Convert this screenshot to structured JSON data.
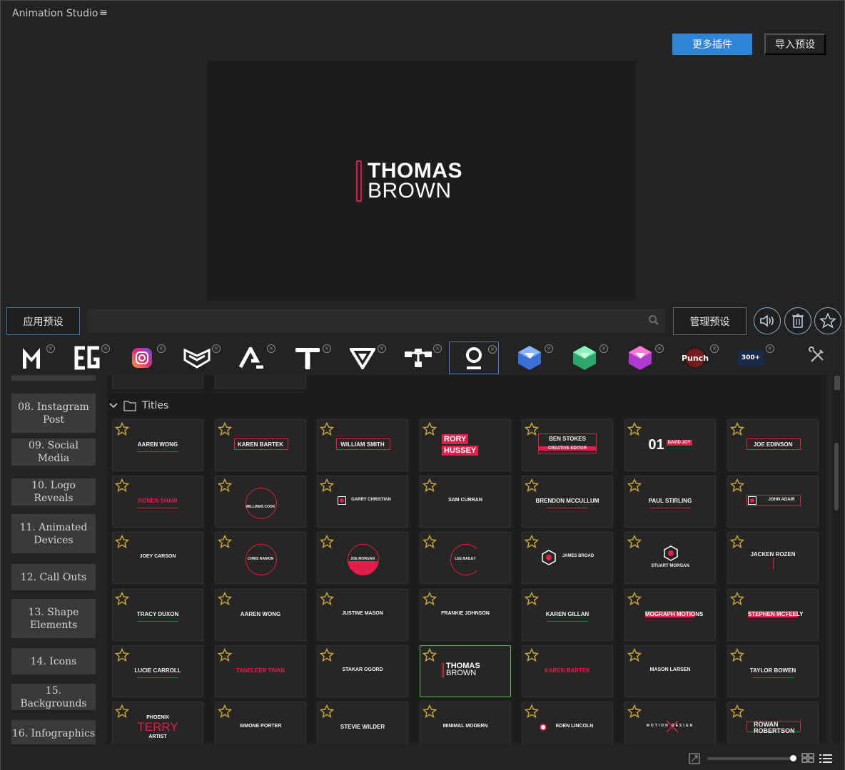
{
  "app": {
    "title": "Animation Studio"
  },
  "header": {
    "more_plugins": "更多插件",
    "import_preset": "导入预设"
  },
  "preview": {
    "line1": "THOMAS",
    "line2": "BROWN",
    "accent": "#e0204a"
  },
  "toolbar": {
    "apply": "应用预设",
    "manage": "管理预设",
    "search_placeholder": ""
  },
  "plugins": [
    {
      "name": "m-logo"
    },
    {
      "name": "eg-logo"
    },
    {
      "name": "instagram-logo"
    },
    {
      "name": "shield-logo"
    },
    {
      "name": "a-logo"
    },
    {
      "name": "t-logo"
    },
    {
      "name": "v-logo"
    },
    {
      "name": "nodes-logo"
    },
    {
      "name": "q-logo"
    },
    {
      "name": "cube-blue"
    },
    {
      "name": "cube-green"
    },
    {
      "name": "cube-pink"
    },
    {
      "name": "punch-logo",
      "label": "Punch"
    },
    {
      "name": "3000-logo",
      "label": "300+"
    }
  ],
  "sidebar": {
    "items": [
      {
        "label": "08. Instagram Post"
      },
      {
        "label": "09. Social Media"
      },
      {
        "label": "10. Logo Reveals"
      },
      {
        "label": "11. Animated Devices"
      },
      {
        "label": "12. Call Outs"
      },
      {
        "label": "13. Shape Elements"
      },
      {
        "label": "14. Icons"
      },
      {
        "label": "15. Backgrounds"
      },
      {
        "label": "16. Infographics"
      }
    ]
  },
  "folder": {
    "label": "Titles"
  },
  "tiles": [
    [
      "AAREN WONG",
      "KAREN BARTEK",
      "WILLIAM SMITH",
      "RORY HUSSEY",
      "BEN STOKES",
      "DAVID JOY",
      "JOE EDINSON"
    ],
    [
      "RONEN SHAW",
      "WILLIAMS COOK",
      "GARRY CHRISTIAN",
      "SAM CURRAN",
      "BRENDON MCCULLUM",
      "PAUL STIRLING",
      "JOHN ADAIR"
    ],
    [
      "JOEY CARSON",
      "CHRIS RANKIN",
      "JOE MORGAN",
      "LEE BAILEY",
      "JAMES BROAD",
      "STUART MORGAN",
      "JACKEN ROZEN"
    ],
    [
      "TRACY DUXON",
      "AAREN WONG",
      "JUSTINE MASON",
      "FRANKIE JOHNSON",
      "KAREN GILLAN",
      "MOGRAPH MOTIONS",
      "STEPHEN MCFEELY"
    ],
    [
      "LUCIE CARROLL",
      "TANELEER TIVAN",
      "STAKAR OGORD",
      "THOMAS BROWN",
      "KAREN BARTEK",
      "MASON LARSEN",
      "TAYLOR BOWEN"
    ],
    [
      "TERRY",
      "SIMONE PORTER",
      "STEVIE WILDER",
      "MINIMAL MODERN",
      "EDEN LINCOLN",
      "MOTION DESIGN",
      "ROWAN ROBERTSON"
    ]
  ],
  "tile_extra": {
    "rory": "RORY",
    "hussey": "HUSSEY",
    "num01": "01",
    "designer": "CREATIVE EDITOR",
    "phoenix": "PHOENIX",
    "artist": "ARTIST",
    "thomas": "THOMAS",
    "brown": "BROWN"
  }
}
